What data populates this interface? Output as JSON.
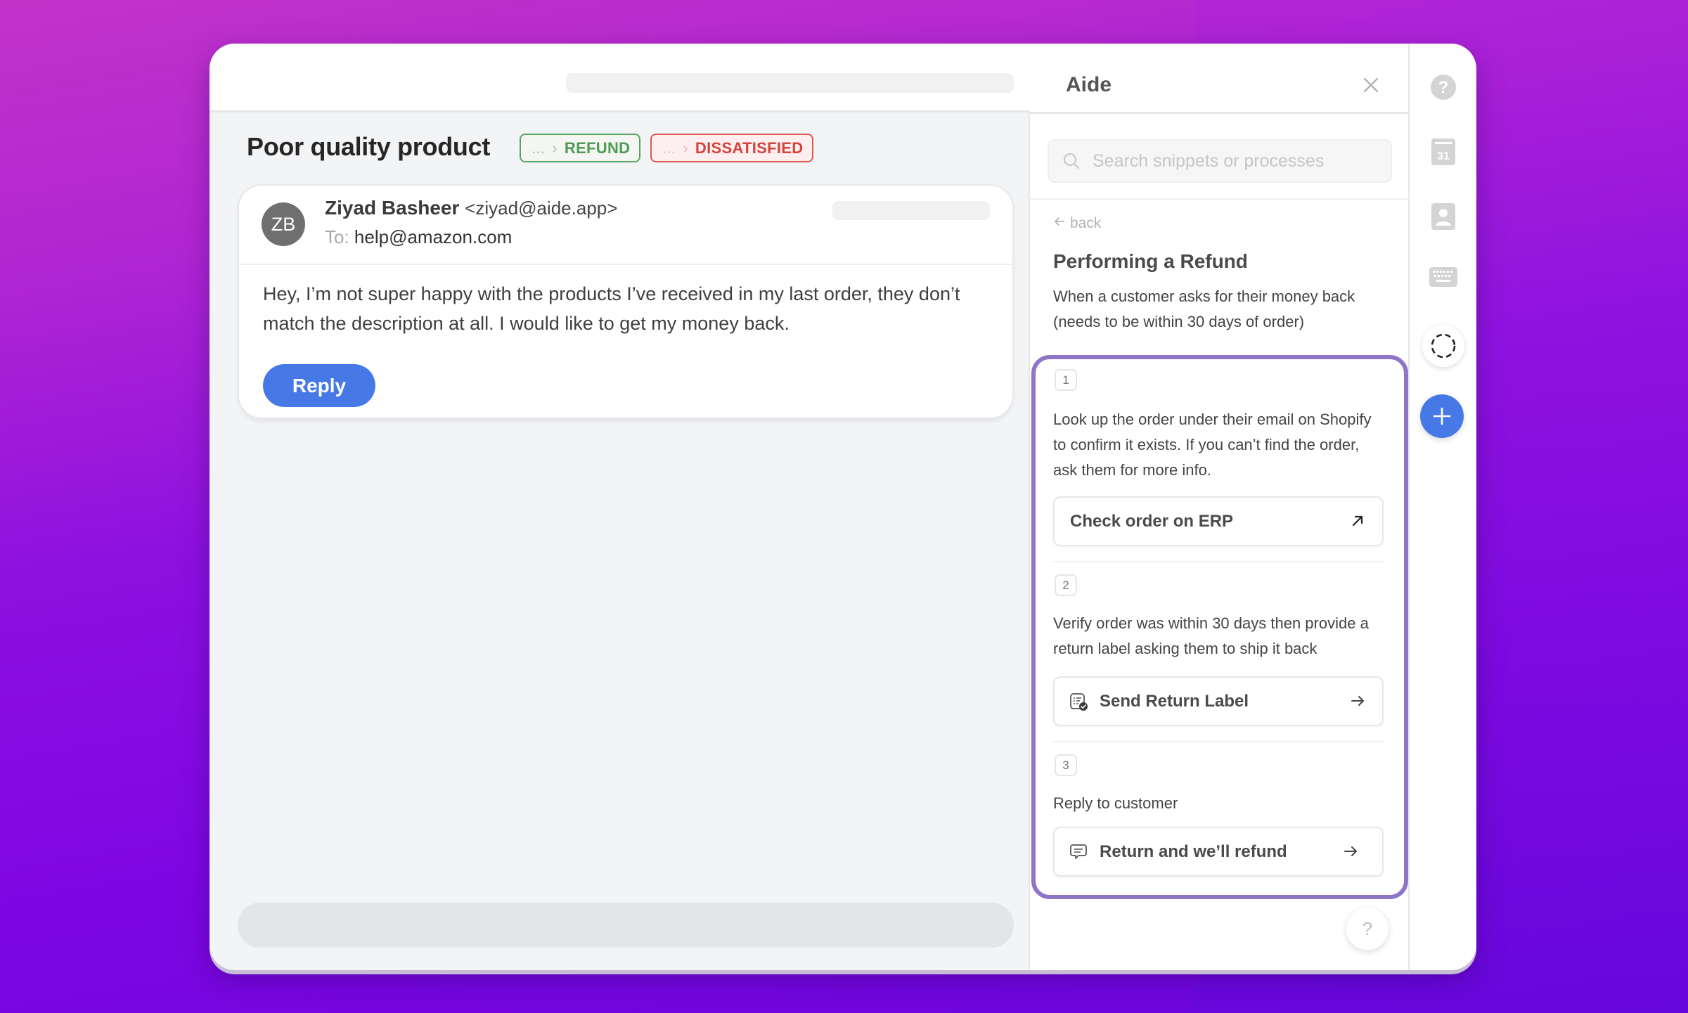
{
  "main": {
    "ticket_title": "Poor quality product",
    "tags": [
      {
        "crumb": "...",
        "label": "REFUND",
        "color": "#4f9a54"
      },
      {
        "crumb": "...",
        "label": "DISSATISFIED",
        "color": "#d3443d"
      }
    ],
    "email": {
      "avatar_initials": "ZB",
      "sender_name": "Ziyad Basheer",
      "sender_email": "<ziyad@aide.app>",
      "to_label": "To:",
      "to_address": "help@amazon.com",
      "body": "Hey, I’m not super happy with the products I’ve received  in my last order, they don’t match the description at all. I would like to get my money back.",
      "reply_label": "Reply"
    }
  },
  "aide": {
    "title": "Aide",
    "search_placeholder": "Search snippets or processes",
    "back_label": "back",
    "process": {
      "title": "Performing a Refund",
      "description": "When a customer asks for their money back (needs to be within 30 days of order)",
      "steps": [
        {
          "number": "1",
          "text": "Look up the order under their email on Shopify to confirm it exists. If you can’t find the order, ask them for more info.",
          "action_label": "Check order on ERP",
          "action_icon": "external-link-icon"
        },
        {
          "number": "2",
          "text": "Verify order was within 30 days then provide a return label asking them to ship it back",
          "action_label": "Send Return Label",
          "action_icon": "checklist-icon"
        },
        {
          "number": "3",
          "text": "Reply to customer",
          "action_label": "Return and we’ll refund",
          "action_icon": "message-icon"
        }
      ]
    },
    "help_label": "?"
  },
  "rail": {
    "items": [
      "help-icon",
      "calendar-icon",
      "contact-icon",
      "keyboard-icon",
      "loading-circle-icon",
      "add-icon"
    ],
    "calendar_day": "31",
    "accent": "#4779e6"
  },
  "colors": {
    "accent_blue": "#4779e6",
    "highlight_purple": "#8f75c8"
  }
}
